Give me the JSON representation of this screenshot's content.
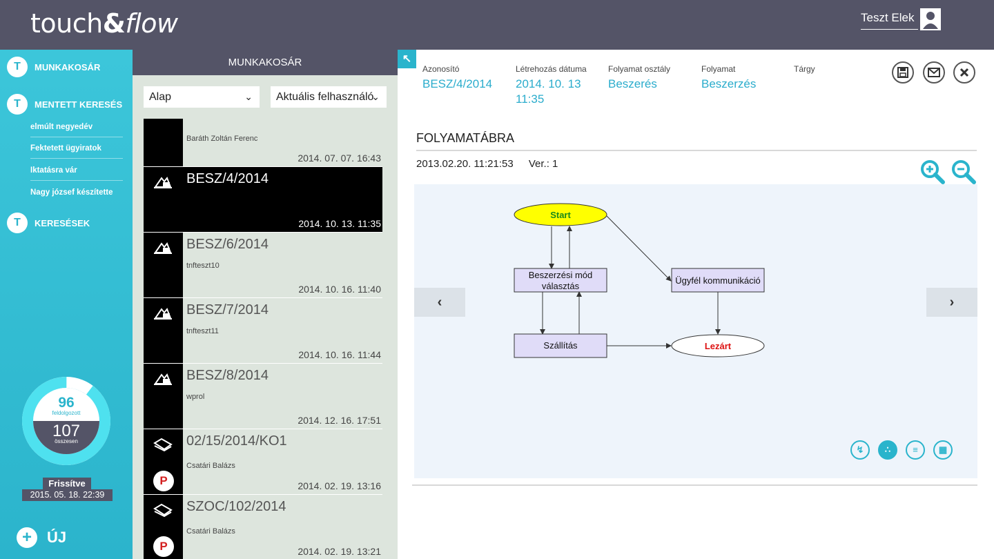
{
  "header": {
    "logo_touch": "touch",
    "logo_amp": "&",
    "logo_flow": "flow",
    "user_name": "Teszt Elek"
  },
  "sidebar": {
    "nav": [
      {
        "label": "MUNKAKOSÁR",
        "icon": "tf-logo-icon"
      },
      {
        "label": "MENTETT KERESÉS",
        "icon": "tf-logo-icon"
      },
      {
        "label": "KERESÉSEK",
        "icon": "tf-logo-icon"
      }
    ],
    "saved_searches": [
      "elmúlt negyedév",
      "Fektetett ügyiratok",
      "Iktatásra vár",
      "Nagy józsef készítette"
    ],
    "stats": {
      "processed": "96",
      "processed_label": "feldolgozott",
      "total": "107",
      "total_label": "összesen",
      "processed_ratio": 0.897
    },
    "refresh_label": "Frissítve",
    "refresh_date": "2015. 05. 18. 22:39",
    "new_label": "ÚJ"
  },
  "worklist": {
    "title": "MUNKAKOSÁR",
    "filter_base": "Alap",
    "filter_user": "Aktuális felhasználó",
    "items": [
      {
        "title": "",
        "subtitle": "Baráth Zoltán Ferenc",
        "date": "2014. 07. 07. 16:43",
        "icon": "none"
      },
      {
        "title": "BESZ/4/2014",
        "subtitle": "",
        "date": "2014. 10. 13. 11:35",
        "icon": "purchase-icon",
        "selected": true
      },
      {
        "title": "BESZ/6/2014",
        "subtitle": "tnfteszt10",
        "date": "2014. 10. 16. 11:40",
        "icon": "purchase-icon"
      },
      {
        "title": "BESZ/7/2014",
        "subtitle": "tnfteszt11",
        "date": "2014. 10. 16. 11:44",
        "icon": "purchase-icon"
      },
      {
        "title": "BESZ/8/2014",
        "subtitle": "wprol",
        "date": "2014. 12. 16. 17:51",
        "icon": "purchase-icon"
      },
      {
        "title": "02/15/2014/KO1",
        "subtitle": "Csatári Balázs",
        "date": "2014. 02. 19. 13:16",
        "icon": "document-icon",
        "flag": true
      },
      {
        "title": "SZOC/102/2014",
        "subtitle": "Csatári Balázs",
        "date": "2014. 02. 19. 13:21",
        "icon": "document-icon",
        "flag": true
      }
    ]
  },
  "detail": {
    "back_icon": "↖",
    "fields": [
      {
        "label": "Azonosító",
        "value": "BESZ/4/2014"
      },
      {
        "label": "Létrehozás dátuma",
        "value": "2014. 10. 13 11:35"
      },
      {
        "label": "Folyamat osztály",
        "value": "Beszerés"
      },
      {
        "label": "Folyamat",
        "value": "Beszerzés"
      },
      {
        "label": "Tárgy",
        "value": ""
      }
    ],
    "actions": [
      "save-icon",
      "mail-icon",
      "close-icon"
    ],
    "section_title": "FOLYAMATÁBRA",
    "version_date": "2013.02.20. 11:21:53",
    "version_label": "Ver.: 1",
    "diagram": {
      "nodes": {
        "start": "Start",
        "choice_line1": "Beszerzési mód",
        "choice_line2": "választás",
        "customer": "Ügyfél kommunikáció",
        "shipping": "Szállítás",
        "closed": "Lezárt"
      }
    },
    "view_buttons": [
      "flow-view-icon",
      "network-view-icon",
      "document-view-icon",
      "table-view-icon"
    ],
    "colors": {
      "accent": "#2ab4cc",
      "header": "#545467",
      "start_node": "#ffff00",
      "closed_text": "#dd1111",
      "node_fill": "#e0dcf8"
    }
  }
}
